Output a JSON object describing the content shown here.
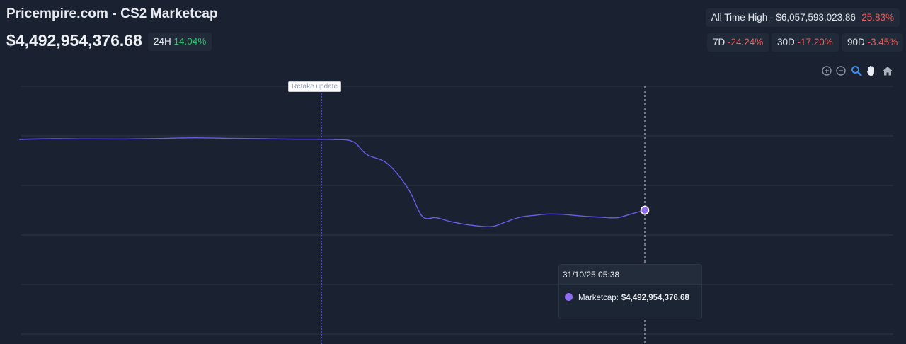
{
  "header": {
    "title": "Pricempire.com - CS2 Marketcap",
    "price": "$4,492,954,376.68",
    "change_24h": {
      "label": "24H",
      "value": "14.04%"
    },
    "all_time_high": {
      "label": "All Time High -",
      "value": "$6,057,593,023.86",
      "change": "-25.83%"
    },
    "periods": [
      {
        "label": "7D",
        "value": "-24.24%"
      },
      {
        "label": "30D",
        "value": "-17.20%"
      },
      {
        "label": "90D",
        "value": "-3.45%"
      }
    ]
  },
  "toolbar": {
    "icons": [
      "zoom-in-icon",
      "zoom-out-icon",
      "zoom-select-icon",
      "pan-icon",
      "home-icon"
    ]
  },
  "colors": {
    "background": "#1a2130",
    "line": "#6a5ce8",
    "marker": "#8f6cf0",
    "positive": "#2fbf6d",
    "negative": "#f05a5a",
    "grid": "#2b3648"
  },
  "chart_data": {
    "type": "line",
    "title": "",
    "xlabel": "",
    "ylabel": "",
    "grid": true,
    "series": [
      {
        "name": "Marketcap",
        "x": [
          0,
          5,
          10,
          15,
          20,
          25,
          30,
          35,
          40,
          45,
          48,
          50,
          53,
          56,
          58,
          60,
          62,
          65,
          68,
          70,
          72,
          74,
          76,
          78,
          80,
          82,
          84,
          86,
          88,
          90
        ],
        "y": [
          6.025,
          6.04,
          6.035,
          6.034,
          6.045,
          6.06,
          6.05,
          6.04,
          6.03,
          6.025,
          5.98,
          5.7,
          5.5,
          4.95,
          4.36,
          4.33,
          4.25,
          4.17,
          4.14,
          4.24,
          4.34,
          4.38,
          4.41,
          4.405,
          4.38,
          4.355,
          4.34,
          4.33,
          4.41,
          4.493
        ]
      }
    ],
    "annotations": [
      {
        "x": 43.5,
        "label": "Retake update"
      }
    ],
    "tooltip": {
      "date": "31/10/25 05:38",
      "series": "Marketcap:",
      "value": "$4,492,954,376.68"
    },
    "hover_x": 90
  }
}
